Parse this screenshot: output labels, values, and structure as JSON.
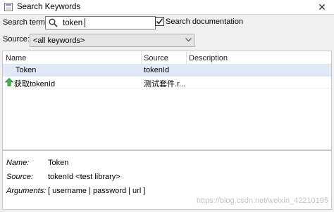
{
  "window": {
    "title": "Search Keywords",
    "close_glyph": "✕"
  },
  "search": {
    "label": "Search term:",
    "value": "token",
    "doc_checked": true,
    "doc_label": "Search documentation"
  },
  "source": {
    "label": "Source:",
    "selected": "<all keywords>"
  },
  "table": {
    "columns": [
      "Name",
      "Source",
      "Description"
    ],
    "rows": [
      {
        "name": "Token",
        "source": "tokenId",
        "description": ""
      },
      {
        "name": "获取tokenId",
        "source": "测试套件.r...",
        "description": "",
        "icon": "green-up-arrow-icon"
      }
    ]
  },
  "details": {
    "name_label": "Name:",
    "name_value": "Token",
    "source_label": "Source:",
    "source_value": "tokenId <test library>",
    "args_label": "Arguments:",
    "args_value": "[ username | password | url ]"
  },
  "watermark": "https://blog.csdn.net/weixin_42210195"
}
